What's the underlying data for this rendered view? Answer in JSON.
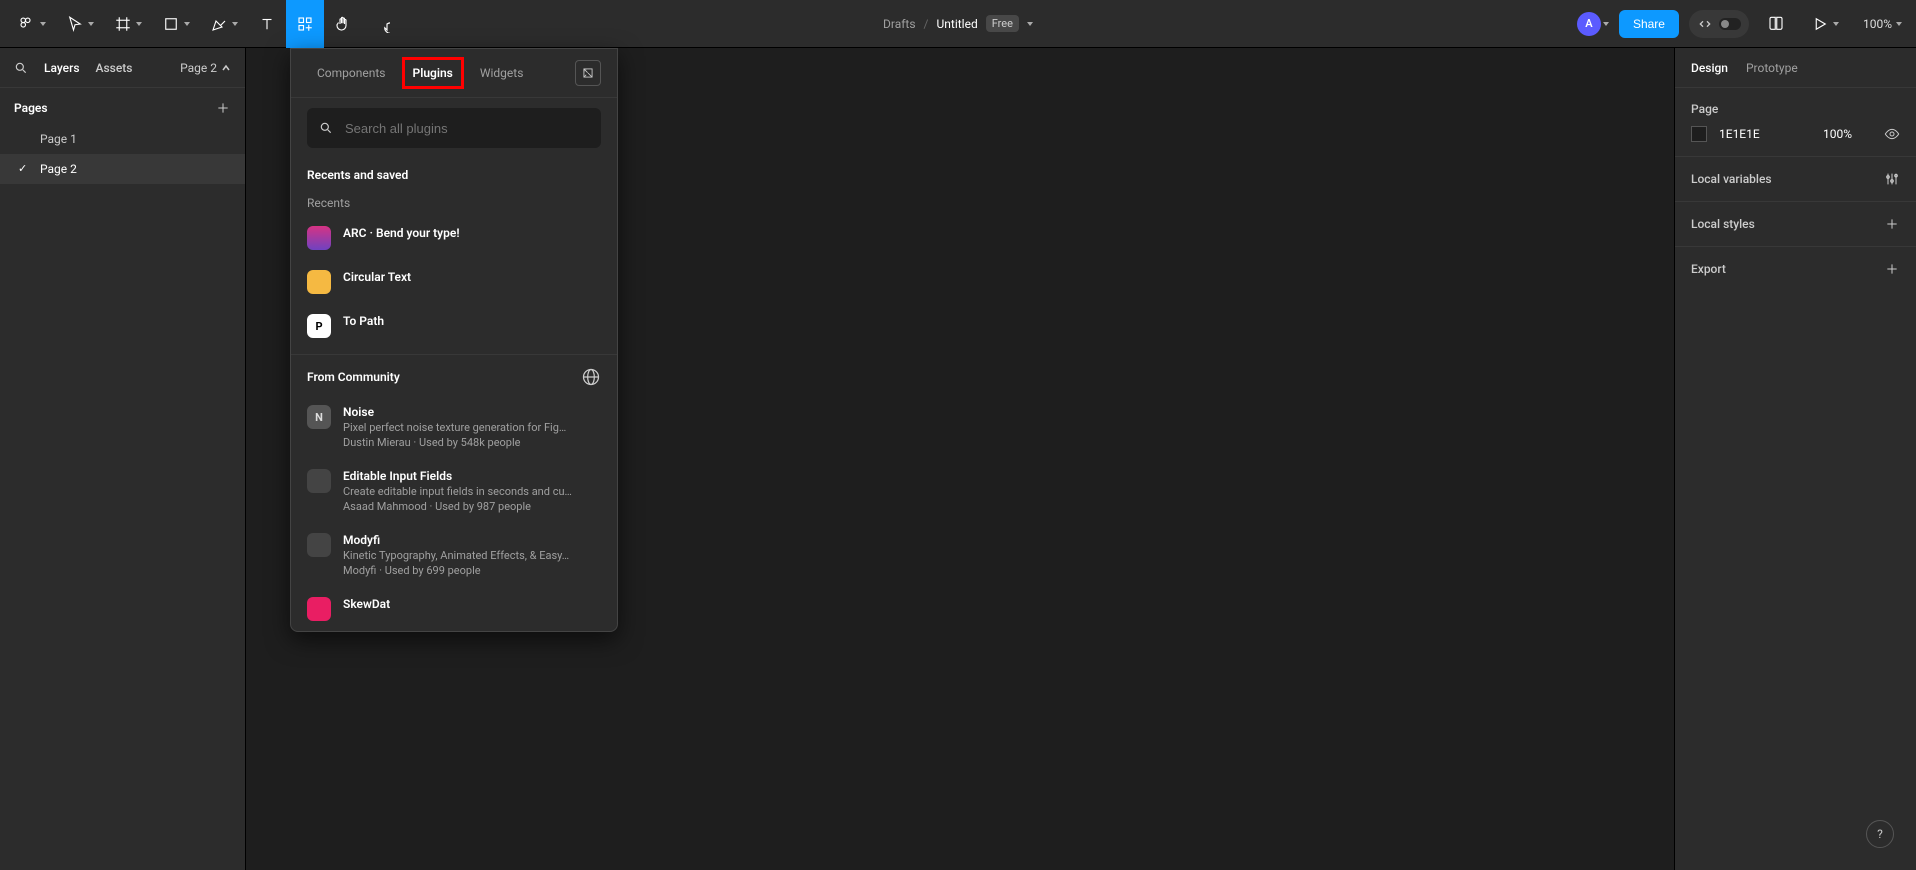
{
  "toolbar": {
    "title_location": "Drafts",
    "title_name": "Untitled",
    "badge": "Free",
    "avatar_initial": "A",
    "share_label": "Share",
    "zoom_level": "100%"
  },
  "left_panel": {
    "search_label": "",
    "tab_layers": "Layers",
    "tab_assets": "Assets",
    "page_selector_label": "Page 2",
    "pages_header": "Pages",
    "pages": [
      {
        "label": "Page 1",
        "current": false
      },
      {
        "label": "Page 2",
        "current": true
      }
    ]
  },
  "resources": {
    "tab_components": "Components",
    "tab_plugins": "Plugins",
    "tab_widgets": "Widgets",
    "active_tab": "Plugins",
    "search_placeholder": "Search all plugins",
    "recents_and_saved_header": "Recents and saved",
    "recents_label": "Recents",
    "recents": [
      {
        "name": "ARC · Bend your type!",
        "icon_bg": "linear-gradient(180deg,#d63384 0%, #6f42c1 100%)",
        "icon_text": ""
      },
      {
        "name": "Circular Text",
        "icon_bg": "#f5b942",
        "icon_text": ""
      },
      {
        "name": "To Path",
        "icon_bg": "#ffffff",
        "icon_text": "P"
      }
    ],
    "from_community_header": "From Community",
    "community": [
      {
        "name": "Noise",
        "desc": "Pixel perfect noise texture generation for Fig…",
        "meta": "Dustin Mierau · Used by 548k people",
        "icon_bg": "#555",
        "icon_text": "N"
      },
      {
        "name": "Editable Input Fields",
        "desc": "Create editable input fields in seconds and cu…",
        "meta": "Asaad Mahmood · Used by 987 people",
        "icon_bg": "#444",
        "icon_text": ""
      },
      {
        "name": "Modyfi",
        "desc": "Kinetic Typography, Animated Effects, & Easy…",
        "meta": "Modyfi · Used by 699 people",
        "icon_bg": "#444",
        "icon_text": ""
      },
      {
        "name": "SkewDat",
        "desc": "",
        "meta": "",
        "icon_bg": "#e91e63",
        "icon_text": ""
      }
    ]
  },
  "right_panel": {
    "tab_design": "Design",
    "tab_prototype": "Prototype",
    "page_section_header": "Page",
    "page_color_hex": "1E1E1E",
    "page_color_opacity": "100%",
    "local_variables_label": "Local variables",
    "local_styles_label": "Local styles",
    "export_label": "Export"
  },
  "help": {
    "label": "?"
  },
  "chart_data": null
}
